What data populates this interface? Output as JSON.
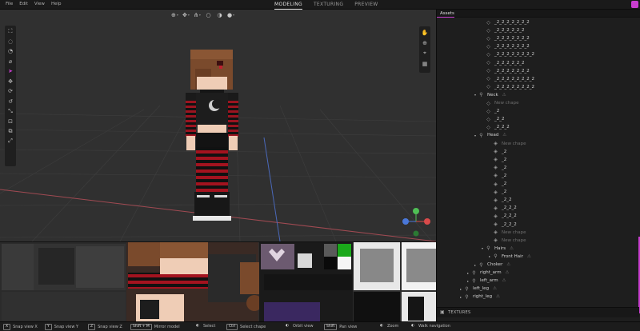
{
  "menu": [
    "File",
    "Edit",
    "View",
    "Help"
  ],
  "modes": [
    {
      "label": "MODELING",
      "active": true
    },
    {
      "label": "TEXTURING",
      "active": false
    },
    {
      "label": "PREVIEW",
      "active": false
    }
  ],
  "viewport_toolbar_icons": [
    "pivot-mode-icon",
    "transform-space-icon",
    "snap-icon",
    "solid-shading-icon",
    "textured-shading-icon",
    "lit-shading-icon"
  ],
  "left_tools": [
    "box-select-icon",
    "lasso-select-icon",
    "brush-select-icon",
    "paint-select-icon",
    "cursor-icon",
    "move-icon",
    "rotate-icon",
    "undo-icon",
    "scale-icon",
    "extrude-icon",
    "duplicate-icon",
    "mirror-icon"
  ],
  "view_tools": [
    "hand-icon",
    "zoom-icon",
    "frame-icon",
    "grid-icon"
  ],
  "assets": {
    "header": "Assets",
    "tree": [
      {
        "label": "_2_2_2_2_2_2_2",
        "indent": 4,
        "icon": "diamond",
        "dim": false
      },
      {
        "label": "_2_2_2_2_2_2",
        "indent": 4,
        "icon": "diamond",
        "dim": false
      },
      {
        "label": "_2_2_2_2_2_2_2",
        "indent": 4,
        "icon": "diamond",
        "dim": false
      },
      {
        "label": "_2_2_2_2_2_2_2",
        "indent": 4,
        "icon": "diamond",
        "dim": false
      },
      {
        "label": "_2_2_2_2_2_2_2_2",
        "indent": 4,
        "icon": "diamond",
        "dim": false
      },
      {
        "label": "_2_2_2_2_2_2",
        "indent": 4,
        "icon": "diamond",
        "dim": false
      },
      {
        "label": "_2_2_2_2_2_2_2",
        "indent": 4,
        "icon": "diamond",
        "dim": false
      },
      {
        "label": "_2_2_2_2_2_2_2_2",
        "indent": 4,
        "icon": "diamond",
        "dim": false
      },
      {
        "label": "_2_2_2_2_2_2_2_2",
        "indent": 4,
        "icon": "diamond",
        "dim": false
      },
      {
        "label": "Neck",
        "indent": 3,
        "icon": "bone",
        "caret": "open",
        "dim": false
      },
      {
        "label": "New chape",
        "indent": 4,
        "icon": "diamond",
        "dim": true
      },
      {
        "label": "_2",
        "indent": 4,
        "icon": "diamond",
        "dim": false
      },
      {
        "label": "_2_2",
        "indent": 4,
        "icon": "diamond",
        "dim": false
      },
      {
        "label": "_2_2_2",
        "indent": 4,
        "icon": "diamond",
        "dim": false
      },
      {
        "label": "Head",
        "indent": 3,
        "icon": "bone",
        "caret": "open",
        "dim": false
      },
      {
        "label": "New chape",
        "indent": 5,
        "icon": "cube",
        "dim": true
      },
      {
        "label": "_2",
        "indent": 5,
        "icon": "cube",
        "dim": false
      },
      {
        "label": "_2",
        "indent": 5,
        "icon": "cube",
        "dim": false
      },
      {
        "label": "_2",
        "indent": 5,
        "icon": "cube",
        "dim": false
      },
      {
        "label": "_2",
        "indent": 5,
        "icon": "cube",
        "dim": false
      },
      {
        "label": "_2",
        "indent": 5,
        "icon": "cube",
        "dim": false
      },
      {
        "label": "_2",
        "indent": 5,
        "icon": "cube",
        "dim": false
      },
      {
        "label": "_2_2",
        "indent": 5,
        "icon": "cube",
        "dim": false
      },
      {
        "label": "_2_2_2",
        "indent": 5,
        "icon": "cube",
        "dim": false
      },
      {
        "label": "_2_2_2",
        "indent": 5,
        "icon": "cube",
        "dim": false
      },
      {
        "label": "_2_2_2",
        "indent": 5,
        "icon": "cube",
        "dim": false
      },
      {
        "label": "New chape",
        "indent": 5,
        "icon": "cube",
        "dim": true
      },
      {
        "label": "New chape",
        "indent": 5,
        "icon": "cube",
        "dim": true
      },
      {
        "label": "Hairs",
        "indent": 4,
        "icon": "bone",
        "caret": "open",
        "dim": false
      },
      {
        "label": "Front Hair",
        "indent": 5,
        "icon": "bone",
        "caret": "closed",
        "dim": false
      },
      {
        "label": "Choker",
        "indent": 3,
        "icon": "bone",
        "caret": "closed",
        "dim": false
      },
      {
        "label": "right_arm",
        "indent": 2,
        "icon": "bone",
        "caret": "closed",
        "dim": false
      },
      {
        "label": "left_arm",
        "indent": 2,
        "icon": "bone",
        "caret": "closed",
        "dim": false
      },
      {
        "label": "left_leg",
        "indent": 1,
        "icon": "bone",
        "caret": "closed",
        "dim": false
      },
      {
        "label": "right_leg",
        "indent": 1,
        "icon": "bone",
        "caret": "closed",
        "dim": false
      }
    ]
  },
  "textures_label": "TEXTURES",
  "status": [
    {
      "key": "X",
      "label": "Snap view X"
    },
    {
      "key": "Y",
      "label": "Snap view Y"
    },
    {
      "key": "Z",
      "label": "Snap view Z"
    },
    {
      "key": "Shift + M",
      "label": "Mirror model"
    },
    {
      "key": "",
      "label": "Select"
    },
    {
      "key": "Ctrl",
      "label": "Select chape"
    },
    {
      "key": "",
      "label": "Orbit view"
    },
    {
      "key": "Shift",
      "label": "Pan view"
    },
    {
      "key": "",
      "label": "Zoom"
    },
    {
      "key": "",
      "label": "Walk navigation"
    }
  ],
  "colors": {
    "accent": "#c83dcf",
    "x_axis": "#d94a4a",
    "y_axis": "#4fbf55",
    "z_axis": "#4a78d9",
    "stripe_red": "#a3131f"
  }
}
